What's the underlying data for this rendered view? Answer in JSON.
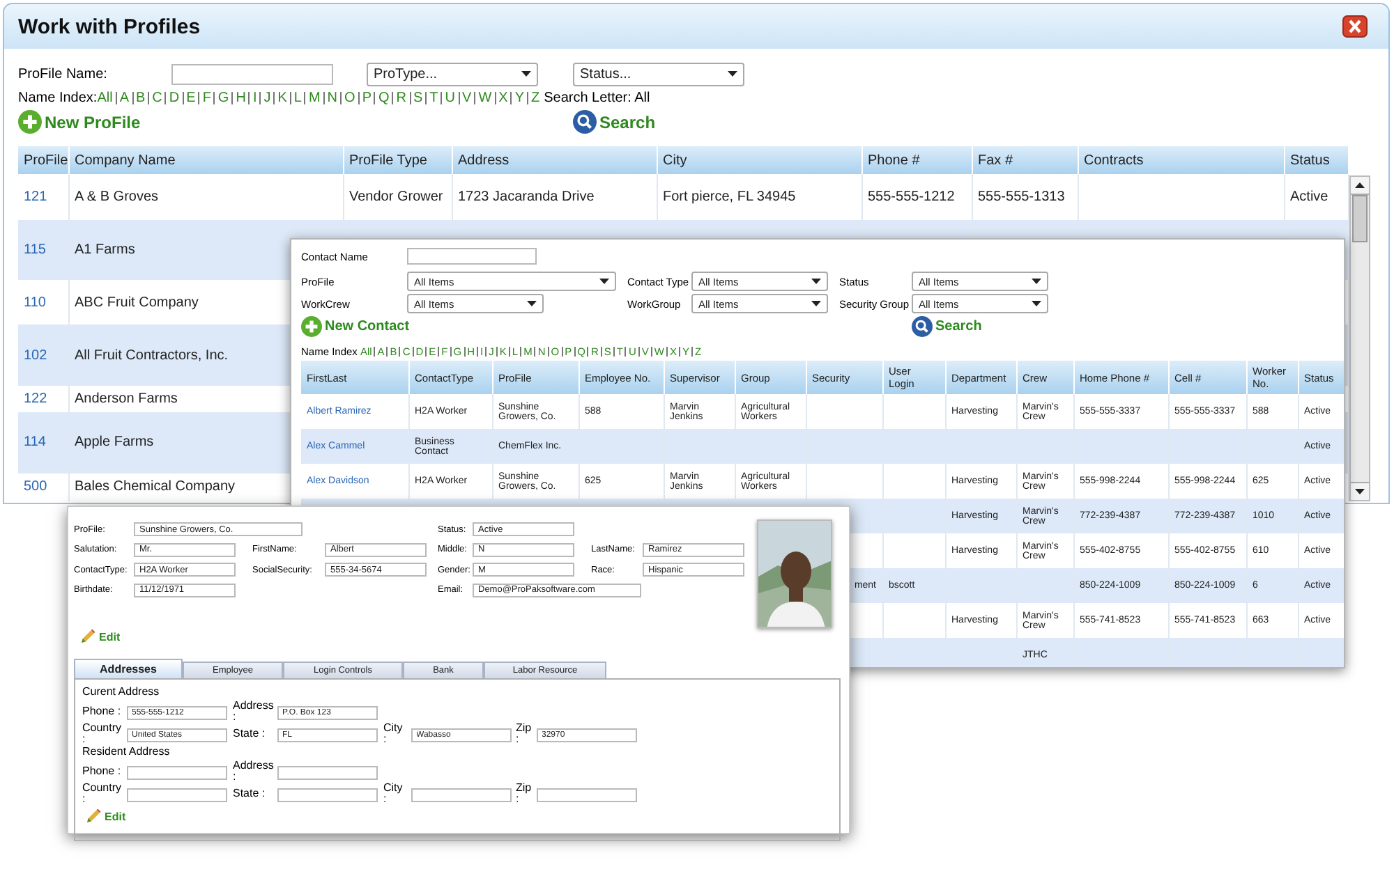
{
  "profiles_window": {
    "title": "Work with Profiles",
    "profile_name_label": "ProFile Name:",
    "protype_dropdown": "ProType...",
    "status_dropdown": "Status...",
    "name_index_label": "Name Index:",
    "letters": [
      "All",
      "A",
      "B",
      "C",
      "D",
      "E",
      "F",
      "G",
      "H",
      "I",
      "J",
      "K",
      "L",
      "M",
      "N",
      "O",
      "P",
      "Q",
      "R",
      "S",
      "T",
      "U",
      "V",
      "W",
      "X",
      "Y",
      "Z"
    ],
    "search_letter": "Search Letter: All",
    "new_button": "New ProFile",
    "search_button": "Search",
    "table": {
      "columns": [
        "ProFile",
        "Company Name",
        "ProFile Type",
        "Address",
        "City",
        "Phone #",
        "Fax #",
        "Contracts",
        "Status"
      ],
      "rows": [
        {
          "profile": "121",
          "company_name": "A & B Groves",
          "profile_type": "Vendor Grower",
          "address": "1723 Jacaranda Drive",
          "city": "Fort pierce, FL 34945",
          "phone": "555-555-1212",
          "fax": "555-555-1313",
          "status": "Active"
        },
        {
          "profile": "115",
          "company_name": "A1 Farms"
        },
        {
          "profile": "110",
          "company_name": "ABC Fruit Company"
        },
        {
          "profile": "102",
          "company_name": "All Fruit Contractors, Inc."
        },
        {
          "profile": "122",
          "company_name": "Anderson Farms"
        },
        {
          "profile": "114",
          "company_name": "Apple Farms"
        },
        {
          "profile": "500",
          "company_name": "Bales Chemical Company"
        }
      ]
    }
  },
  "contacts_window": {
    "contact_name_label": "Contact Name",
    "filters": [
      {
        "label": "ProFile",
        "value": "All Items"
      },
      {
        "label": "Contact Type",
        "value": "All Items"
      },
      {
        "label": "Status",
        "value": "All Items"
      },
      {
        "label": "WorkCrew",
        "value": "All Items"
      },
      {
        "label": "WorkGroup",
        "value": "All Items"
      },
      {
        "label": "Security Group",
        "value": "All Items"
      }
    ],
    "new_button": "New Contact",
    "search_button": "Search",
    "name_index_label": "Name Index",
    "letters": [
      "All",
      "A",
      "B",
      "C",
      "D",
      "E",
      "F",
      "G",
      "H",
      "I",
      "J",
      "K",
      "L",
      "M",
      "N",
      "O",
      "P",
      "Q",
      "R",
      "S",
      "T",
      "U",
      "V",
      "W",
      "X",
      "Y",
      "Z"
    ],
    "table": {
      "columns": [
        "FirstLast",
        "ContactType",
        "ProFile",
        "Employee No.",
        "Supervisor",
        "Group",
        "Security",
        "User Login",
        "Department",
        "Crew",
        "Home Phone #",
        "Cell #",
        "Worker No.",
        "Status"
      ],
      "rows": [
        {
          "first_last": "Albert Ramirez",
          "contact_type": "H2A Worker",
          "profile": "Sunshine Growers, Co.",
          "employee_no": "588",
          "supervisor": "Marvin Jenkins",
          "group": "Agricultural Workers",
          "department": "Harvesting",
          "crew": "Marvin's Crew",
          "home_phone": "555-555-3337",
          "cell": "555-555-3337",
          "worker_no": "588",
          "status": "Active"
        },
        {
          "first_last": "Alex Cammel",
          "contact_type": "Business Contact",
          "profile": "ChemFlex Inc.",
          "status": "Active"
        },
        {
          "first_last": "Alex Davidson",
          "contact_type": "H2A Worker",
          "profile": "Sunshine Growers, Co.",
          "employee_no": "625",
          "supervisor": "Marvin Jenkins",
          "group": "Agricultural Workers",
          "department": "Harvesting",
          "crew": "Marvin's Crew",
          "home_phone": "555-998-2244",
          "cell": "555-998-2244",
          "worker_no": "625",
          "status": "Active"
        },
        {
          "department": "Harvesting",
          "crew": "Marvin's Crew",
          "home_phone": "772-239-4387",
          "cell": "772-239-4387",
          "worker_no": "1010",
          "status": "Active"
        },
        {
          "department": "Harvesting",
          "crew": "Marvin's Crew",
          "home_phone": "555-402-8755",
          "cell": "555-402-8755",
          "worker_no": "610",
          "status": "Active"
        },
        {
          "security": "ment",
          "user_login": "bscott",
          "home_phone": "850-224-1009",
          "cell": "850-224-1009",
          "worker_no": "6",
          "status": "Active"
        },
        {
          "department": "Harvesting",
          "crew": "Marvin's Crew",
          "home_phone": "555-741-8523",
          "cell": "555-741-8523",
          "worker_no": "663",
          "status": "Active"
        },
        {
          "crew": "JTHC"
        }
      ]
    }
  },
  "contact_detail": {
    "fields": [
      {
        "label": "ProFile:",
        "value": "Sunshine Growers, Co."
      },
      {
        "label": "Status:",
        "value": "Active"
      },
      {
        "label": "Salutation:",
        "value": "Mr."
      },
      {
        "label": "FirstName:",
        "value": "Albert"
      },
      {
        "label": "Middle:",
        "value": "N"
      },
      {
        "label": "LastName:",
        "value": "Ramirez"
      },
      {
        "label": "ContactType:",
        "value": "H2A Worker"
      },
      {
        "label": "SocialSecurity:",
        "value": "555-34-5674"
      },
      {
        "label": "Gender:",
        "value": "M"
      },
      {
        "label": "Race:",
        "value": "Hispanic"
      },
      {
        "label": "Birthdate:",
        "value": "11/12/1971"
      },
      {
        "label": "Email:",
        "value": "Demo@ProPaksoftware.com"
      }
    ],
    "edit_button": "Edit",
    "tabs": [
      {
        "label": "Addresses",
        "selected": true
      },
      {
        "label": "Employee",
        "selected": false
      },
      {
        "label": "Login Controls",
        "selected": false
      },
      {
        "label": "Bank",
        "selected": false
      },
      {
        "label": "Labor Resource",
        "selected": false
      }
    ],
    "current_address": {
      "heading": "Curent Address",
      "fields": [
        {
          "label": "Phone :",
          "value": "555-555-1212"
        },
        {
          "label": "Address :",
          "value": "P.O. Box 123"
        },
        {
          "label": "Country :",
          "value": "United States"
        },
        {
          "label": "State :",
          "value": "FL"
        },
        {
          "label": "City :",
          "value": "Wabasso"
        },
        {
          "label": "Zip :",
          "value": "32970"
        }
      ]
    },
    "resident_address": {
      "heading": "Resident Address",
      "fields": [
        {
          "label": "Phone :"
        },
        {
          "label": "Address :"
        },
        {
          "label": "Country :"
        },
        {
          "label": "State :"
        },
        {
          "label": "City :"
        },
        {
          "label": "Zip :"
        }
      ]
    },
    "address_edit_button": "Edit"
  }
}
